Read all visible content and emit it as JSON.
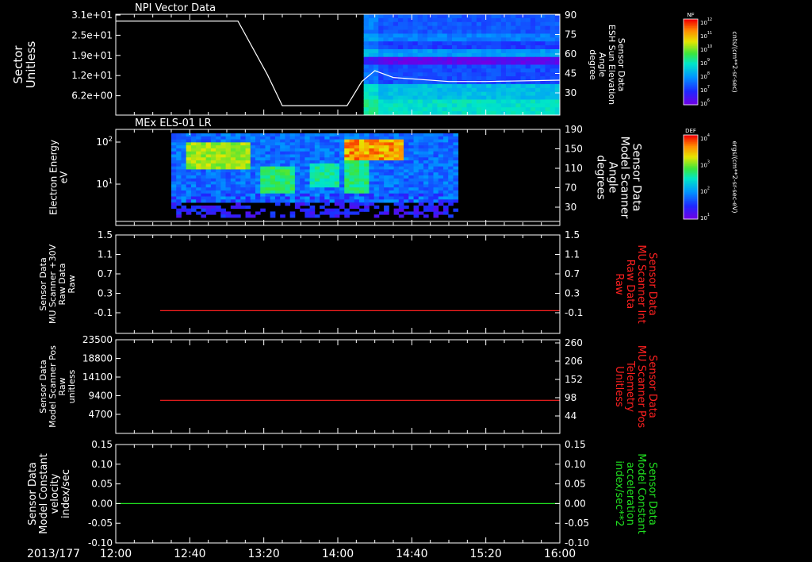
{
  "figure": {
    "date_label": "2013/177",
    "x_ticks": [
      "12:00",
      "12:40",
      "13:20",
      "14:00",
      "14:40",
      "15:20",
      "16:00"
    ]
  },
  "colors": {
    "background": "#000000",
    "axis": "#ffffff",
    "red_trace": "#ff2020",
    "green_trace": "#20e020",
    "white_trace": "#ffffff"
  },
  "chart_data": [
    {
      "type": "heatmap",
      "title": "NPI Vector Data",
      "ylabel_left": [
        "Sector",
        "Unitless"
      ],
      "ylabel_right": [
        "Sensor Data",
        "ESH Sun Elevation",
        "Angle",
        "degree"
      ],
      "left_ticks": [
        "3.1e+01",
        "2.5e+01",
        "1.9e+01",
        "1.2e+01",
        "6.2e+00"
      ],
      "right_ticks": [
        "90",
        "75",
        "60",
        "45",
        "30"
      ],
      "right_ylim": [
        15,
        90
      ],
      "colorbar": {
        "label": "NF",
        "units": "cnts/(cm**2-sr-sec)",
        "ticks": [
          "10^12",
          "10^11",
          "10^10",
          "10^9",
          "10^8",
          "10^7",
          "10^6"
        ]
      },
      "spectrogram_start": "14:14",
      "line": {
        "name": "ESH Sun Elevation",
        "x": [
          "12:00",
          "13:06",
          "13:22",
          "13:30",
          "14:05",
          "14:13",
          "14:20",
          "14:30",
          "15:00",
          "15:20",
          "16:00"
        ],
        "y": [
          85,
          85,
          45,
          22,
          22,
          40,
          48,
          43,
          40,
          40,
          41
        ]
      }
    },
    {
      "type": "heatmap",
      "title": "MEx ELS-01 LR",
      "ylabel_left": [
        "Electron Energy",
        "eV"
      ],
      "ylabel_right": [
        "Sensor Data",
        "Model Scanner",
        "Angle",
        "degrees"
      ],
      "left_ticks": [
        "10^2",
        "10^1"
      ],
      "right_ticks": [
        "190",
        "150",
        "110",
        "70",
        "30"
      ],
      "right_ylim": [
        0,
        190
      ],
      "colorbar": {
        "label": "DEF",
        "units": "ergs/(cm**2-sr-sec-eV)",
        "ticks": [
          "10^4",
          "10^3",
          "10^2",
          "10^1"
        ]
      },
      "data_span": [
        "12:30",
        "15:05"
      ],
      "line": {
        "name": "Model Scanner Angle",
        "y": 8
      }
    },
    {
      "type": "line",
      "ylabel_left": [
        "Sensor Data",
        "MU Scanner +30V",
        "Raw Data",
        "Raw"
      ],
      "ylabel_right": [
        "Sensor Data",
        "MU Scanner Int",
        "Raw Data",
        "Raw"
      ],
      "left_ticks": [
        "1.5",
        "1.1",
        "0.7",
        "0.3",
        "-0.1"
      ],
      "right_ticks": [
        "1.5",
        "1.1",
        "0.7",
        "0.3",
        "-0.1"
      ],
      "ylim": [
        -0.45,
        1.5
      ],
      "series": [
        {
          "name": "MU Scanner Int",
          "x": [
            "12:24",
            "16:00"
          ],
          "y": [
            0.0,
            0.0
          ],
          "color": "#ff2020"
        }
      ]
    },
    {
      "type": "line",
      "ylabel_left": [
        "Sensor Data",
        "Model Scanner Pos",
        "Raw",
        "unitless"
      ],
      "ylabel_right": [
        "Sensor Data",
        "MU Scanner Pos",
        "Telemetry",
        "Unitless"
      ],
      "left_ticks": [
        "23500",
        "18800",
        "14100",
        "9400",
        "4700"
      ],
      "right_ticks": [
        "260",
        "206",
        "152",
        "98",
        "44"
      ],
      "ylim": [
        0,
        23500
      ],
      "series": [
        {
          "name": "MU Scanner Pos",
          "x": [
            "12:24",
            "16:00"
          ],
          "y": [
            8300,
            8300
          ],
          "color": "#ff2020"
        }
      ]
    },
    {
      "type": "line",
      "ylabel_left": [
        "Sensor Data",
        "Model Constant",
        "velocity",
        "index/sec"
      ],
      "ylabel_right": [
        "Sensor Data",
        "Model Constant",
        "acceleration",
        "index/sec**2"
      ],
      "left_ticks": [
        "0.15",
        "0.10",
        "0.05",
        "0.00",
        "-0.05",
        "-0.10"
      ],
      "right_ticks": [
        "0.15",
        "0.10",
        "0.05",
        "0.00",
        "-0.05",
        "-0.10"
      ],
      "ylim": [
        -0.1,
        0.15
      ],
      "series": [
        {
          "name": "Model Constant acceleration",
          "x": [
            "12:00",
            "16:00"
          ],
          "y": [
            0.0,
            0.0
          ],
          "color": "#20e020"
        }
      ]
    }
  ]
}
